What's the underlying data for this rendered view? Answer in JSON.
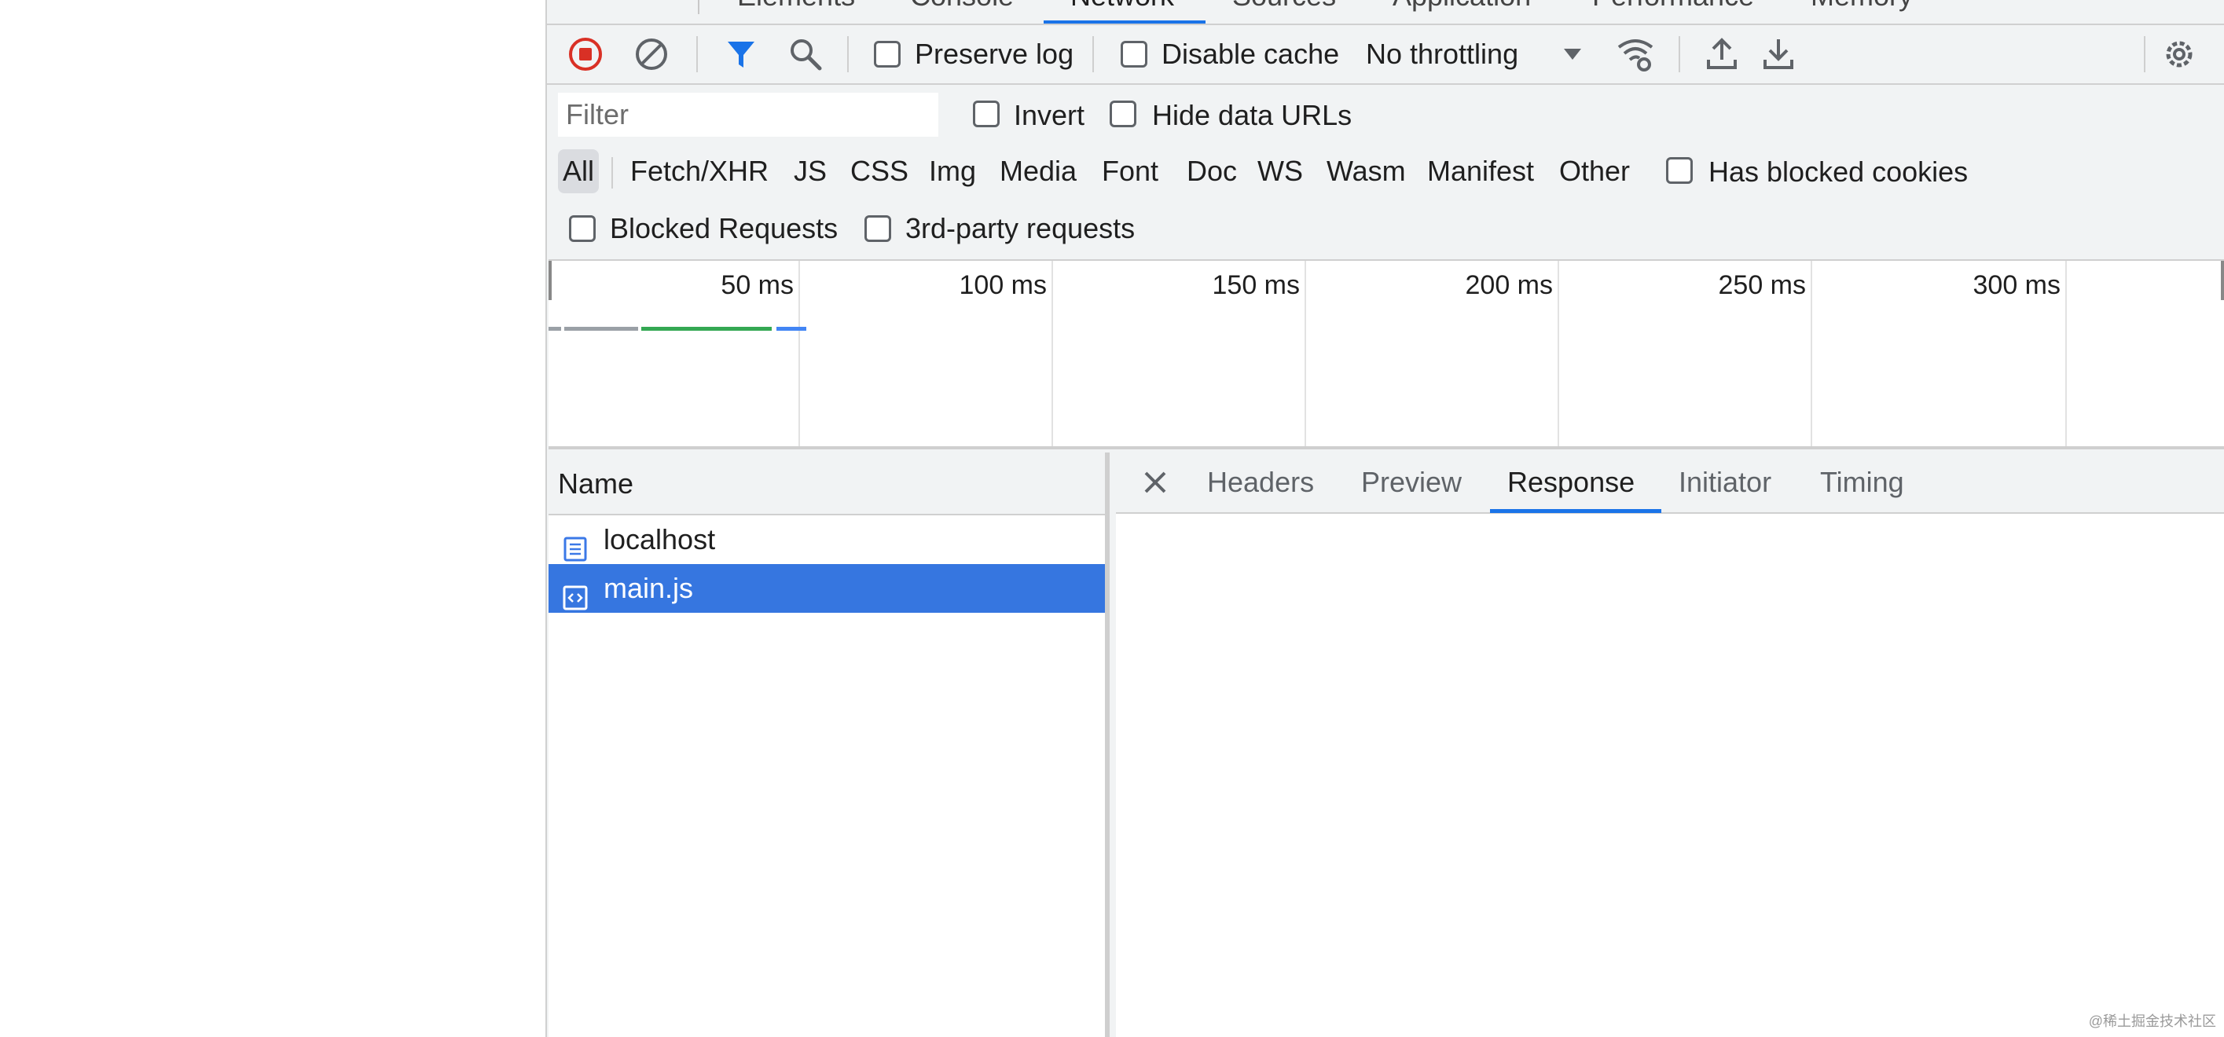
{
  "panel_tabs": [
    "Elements",
    "Console",
    "Network",
    "Sources",
    "Application",
    "Performance",
    "Memory"
  ],
  "toolbar": {
    "record_icon": "record-stop-icon",
    "clear_icon": "clear-icon",
    "filter_icon": "funnel-icon",
    "search_icon": "search-icon",
    "preserve_log_label": "Preserve log",
    "disable_cache_label": "Disable cache",
    "throttling_value": "No throttling",
    "network_conditions_icon": "wifi-settings-icon",
    "import_icon": "upload-icon",
    "export_icon": "download-icon",
    "settings_icon": "gear-icon"
  },
  "filter": {
    "placeholder": "Filter",
    "invert_label": "Invert",
    "hide_data_urls_label": "Hide data URLs",
    "types": [
      "All",
      "Fetch/XHR",
      "JS",
      "CSS",
      "Img",
      "Media",
      "Font",
      "Doc",
      "WS",
      "Wasm",
      "Manifest",
      "Other"
    ],
    "active_type": "All",
    "has_blocked_cookies_label": "Has blocked cookies",
    "blocked_requests_label": "Blocked Requests",
    "third_party_label": "3rd-party requests"
  },
  "overview": {
    "ticks": [
      "50 ms",
      "100 ms",
      "150 ms",
      "200 ms",
      "250 ms",
      "300 ms"
    ],
    "colors": {
      "waiting": "#9aa0a6",
      "download": "#34a853",
      "js": "#4285f4"
    }
  },
  "requests": {
    "column_name": "Name",
    "rows": [
      {
        "name": "localhost",
        "icon": "document-icon",
        "selected": false
      },
      {
        "name": "main.js",
        "icon": "script-icon",
        "selected": true
      }
    ]
  },
  "details": {
    "close_icon": "close-icon",
    "tabs": [
      "Headers",
      "Preview",
      "Response",
      "Initiator",
      "Timing"
    ],
    "active_tab": "Response"
  },
  "watermark": "@稀土掘金技术社区"
}
